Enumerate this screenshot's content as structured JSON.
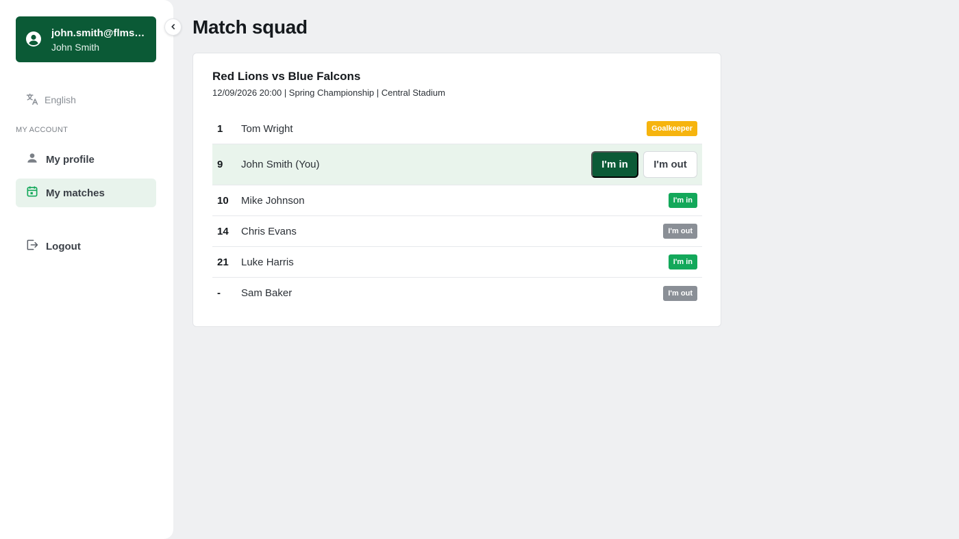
{
  "sidebar": {
    "user": {
      "email": "john.smith@flmsoccer.com",
      "name": "John Smith"
    },
    "language": "English",
    "section_label": "MY ACCOUNT",
    "items": [
      {
        "label": "My profile",
        "icon": "person-icon"
      },
      {
        "label": "My matches",
        "icon": "calendar-icon",
        "active": true
      },
      {
        "label": "Logout",
        "icon": "logout-icon"
      }
    ]
  },
  "main": {
    "title": "Match squad",
    "match": {
      "title": "Red Lions vs Blue Falcons",
      "meta": "12/09/2026 20:00 | Spring Championship | Central Stadium"
    },
    "players": [
      {
        "number": "1",
        "name": "Tom Wright",
        "status": "Goalkeeper"
      },
      {
        "number": "9",
        "name": "John Smith (You)",
        "status": ""
      },
      {
        "number": "10",
        "name": "Mike Johnson",
        "status": "I'm in"
      },
      {
        "number": "14",
        "name": "Chris Evans",
        "status": "I'm out"
      },
      {
        "number": "21",
        "name": "Luke Harris",
        "status": "I'm in"
      },
      {
        "number": "-",
        "name": "Sam Baker",
        "status": "I'm out"
      }
    ],
    "actions": {
      "in_label": "I'm in",
      "out_label": "I'm out"
    }
  },
  "colors": {
    "brand": "#0b5a36",
    "goalkeeper": "#f6b40e",
    "in": "#13a85a",
    "out": "#8a8f96"
  }
}
